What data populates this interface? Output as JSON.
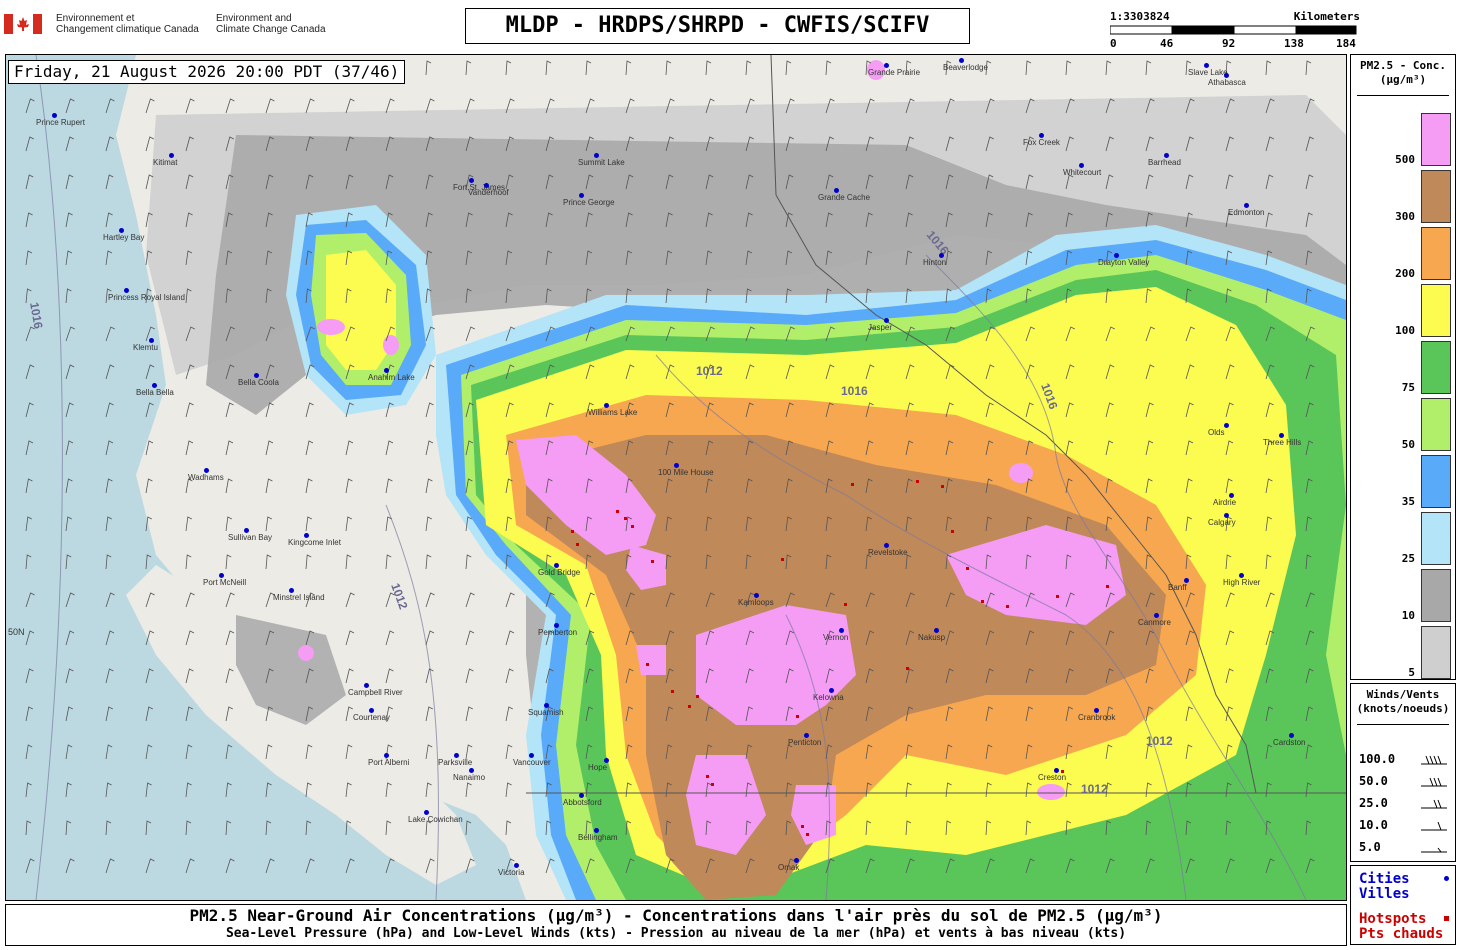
{
  "header": {
    "gov_fr_line1": "Environnement et",
    "gov_fr_line2": "Changement climatique Canada",
    "gov_en_line1": "Environment and",
    "gov_en_line2": "Climate Change Canada",
    "title": "MLDP - HRDPS/SHRPD - CWFIS/SCIFV"
  },
  "scale": {
    "ratio": "1:3303824",
    "unit": "Kilometers",
    "ticks": [
      "0",
      "46",
      "92",
      "138",
      "184"
    ]
  },
  "map": {
    "timestamp": "Friday, 21 August 2026 20:00 PDT (37/46)",
    "isobar_labels": [
      "1016",
      "1012",
      "1016",
      "1012",
      "1016",
      "1012",
      "1016",
      "1012"
    ],
    "cities": [
      "Prince Rupert",
      "Kitimat",
      "Hartley Bay",
      "Princess Royal Island",
      "Klemtu",
      "Bella Bella",
      "Bella Coola",
      "Anahim Lake",
      "Wadhams",
      "Sullivan Bay",
      "Kingcome Inlet",
      "Port McNeill",
      "Minstrel Island",
      "Campbell River",
      "Courtenay",
      "Port Alberni",
      "Parksville",
      "Nanaimo",
      "Lake Cowichan",
      "Victoria",
      "Vancouver",
      "Squamish",
      "Pemberton",
      "Gold Bridge",
      "Abbotsford",
      "Bellingham",
      "Prince George",
      "Fort St. James",
      "Vanderhoof",
      "Summit Lake",
      "Williams Lake",
      "100 Mile House",
      "Kamloops",
      "Vernon",
      "Kelowna",
      "Penticton",
      "Nakusp",
      "Revelstoke",
      "Cranbrook",
      "Creston",
      "Calgary",
      "Airdrie",
      "Edmonton",
      "Barrhead",
      "Whitecourt",
      "Grande Cache",
      "Hinton",
      "Jasper",
      "Drayton Valley",
      "Three Hills",
      "Olds",
      "Banff",
      "Canmore",
      "High River",
      "Cardston",
      "Fox Creek",
      "Grande Prairie",
      "Beaverlodge",
      "Slave Lake",
      "Athabasca",
      "Hope",
      "Omak"
    ],
    "lat_label": "50N"
  },
  "legend": {
    "title_line1": "PM2.5 - Conc.",
    "title_line2": "(µg/m³)",
    "bins": [
      {
        "label": "500",
        "color": "#f59cf5"
      },
      {
        "label": "300",
        "color": "#c0895a"
      },
      {
        "label": "200",
        "color": "#f7a74f"
      },
      {
        "label": "100",
        "color": "#fcfc50"
      },
      {
        "label": "75",
        "color": "#5ac65a"
      },
      {
        "label": "50",
        "color": "#b1ef6a"
      },
      {
        "label": "35",
        "color": "#59aaf8"
      },
      {
        "label": "25",
        "color": "#b3e4f7"
      },
      {
        "label": "10",
        "color": "#a8a8a8"
      },
      {
        "label": "5",
        "color": "#cfcfcf"
      }
    ]
  },
  "winds": {
    "title_line1": "Winds/Vents",
    "title_line2": "(knots/noeuds)",
    "rows": [
      "100.0",
      "50.0",
      "25.0",
      "10.0",
      "5.0"
    ]
  },
  "keys": {
    "cities_en": "Cities",
    "cities_fr": "Villes",
    "hot_en": "Hotspots",
    "hot_fr": "Pts chauds",
    "cities_color": "#0000cc",
    "hot_color": "#cc0000"
  },
  "footer": {
    "line1": "PM2.5 Near-Ground Air Concentrations (µg/m³) - Concentrations dans l'air près du sol de PM2.5 (µg/m³)",
    "line2": "Sea-Level Pressure (hPa) and Low-Level Winds (kts) - Pression au niveau de la mer (hPa) et vents à bas niveau (kts)"
  }
}
